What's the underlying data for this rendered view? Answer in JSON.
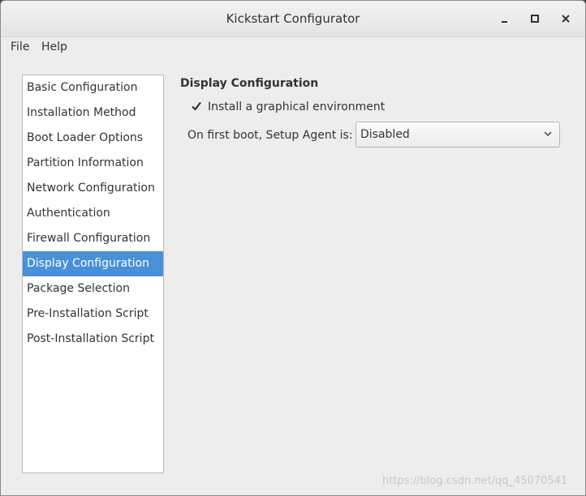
{
  "window": {
    "title": "Kickstart Configurator"
  },
  "menubar": {
    "file": "File",
    "help": "Help"
  },
  "sidebar": {
    "items": [
      {
        "label": "Basic Configuration",
        "selected": false
      },
      {
        "label": "Installation Method",
        "selected": false
      },
      {
        "label": "Boot Loader Options",
        "selected": false
      },
      {
        "label": "Partition Information",
        "selected": false
      },
      {
        "label": "Network Configuration",
        "selected": false
      },
      {
        "label": "Authentication",
        "selected": false
      },
      {
        "label": "Firewall Configuration",
        "selected": false
      },
      {
        "label": "Display Configuration",
        "selected": true
      },
      {
        "label": "Package Selection",
        "selected": false
      },
      {
        "label": "Pre-Installation Script",
        "selected": false
      },
      {
        "label": "Post-Installation Script",
        "selected": false
      }
    ]
  },
  "display": {
    "section_title": "Display Configuration",
    "graphical_env_label": "Install a graphical environment",
    "graphical_env_checked": true,
    "setup_agent_label": "On first boot, Setup Agent is:",
    "setup_agent_value": "Disabled"
  },
  "watermark": "https://blog.csdn.net/qq_45070541",
  "colors": {
    "selection": "#4a90d9",
    "window_bg": "#ededed"
  },
  "icons": {
    "minimize": "minimize-icon",
    "maximize": "maximize-icon",
    "close": "close-icon",
    "checkbox": "checkmark-icon",
    "combo_arrow": "chevron-down-icon"
  }
}
